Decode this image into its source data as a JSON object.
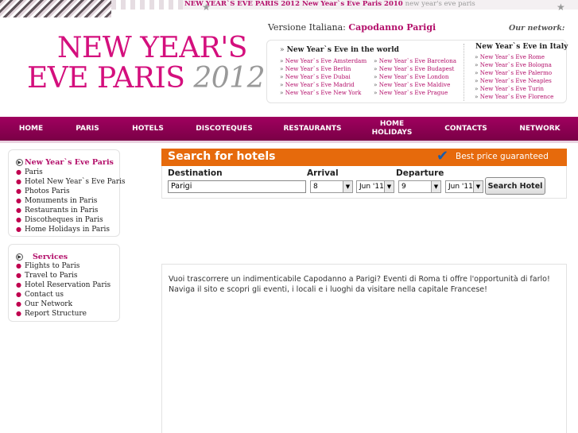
{
  "topbar": {
    "title1": "NEW YEAR`S EVE PARIS 2012",
    "title2": "New Year`s Eve Paris 2010",
    "title3": "new year's eve paris"
  },
  "logo": {
    "line1": "NEW YEAR'S",
    "line2": "EVE PARIS",
    "year": "2012"
  },
  "header": {
    "version_label": "Versione Italiana:",
    "version_link": "Capodanno Parigi",
    "our_network": "Our network:"
  },
  "world": {
    "title": "New Year`s Eve in the world",
    "col1": [
      "New Year`s Eve Amsterdam",
      "New Year`s Eve Berlin",
      "New Year`s Eve Dubai",
      "New Year`s Eve Madrid",
      "New Year`s Eve New York"
    ],
    "col2": [
      "New Year`s Eve Barcelona",
      "New Year`s Eve Budapest",
      "New Year`s Eve London",
      "New Year`s Eve Maldive",
      "New Year`s Eve Prague"
    ]
  },
  "italy": {
    "title": "New Year`s Eve in Italy",
    "items": [
      "New Year`s Eve Rome",
      "New Year`s Eve Bologna",
      "New Year`s Eve Palermo",
      "New Year`s Eve Neaples",
      "New Year`s Eve Turin",
      "New Year`s Eve Florence"
    ]
  },
  "nav": {
    "home": "HOME",
    "paris": "PARIS",
    "hotels": "HOTELS",
    "discoteques": "DISCOTEQUES",
    "restaurants": "RESTAURANTS",
    "home_holidays_1": "HOME",
    "home_holidays_2": "HOLIDAYS",
    "contacts": "CONTACTS",
    "network": "NETWORK"
  },
  "sidebar1": {
    "title": "New Year`s Eve Paris",
    "items": [
      "Paris",
      "Hotel New Year`s Eve Paris",
      "Photos Paris",
      "Monuments in Paris",
      "Restaurants in Paris",
      "Discotheques in Paris",
      "Home Holidays in Paris"
    ]
  },
  "sidebar2": {
    "title": "Services",
    "items": [
      "Flights to Paris",
      "Travel to Paris",
      "Hotel Reservation Paris",
      "Contact us",
      "Our Network",
      "Report Structure"
    ]
  },
  "search": {
    "title": "Search for hotels",
    "best_price": "Best price guaranteed",
    "destination_label": "Destination",
    "destination_value": "Parigi",
    "arrival_label": "Arrival",
    "arrival_day": "8",
    "arrival_month": "Jun '11",
    "departure_label": "Departure",
    "departure_day": "9",
    "departure_month": "Jun '11",
    "button": "Search Hotel"
  },
  "intro": {
    "text": "Vuoi trascorrere un indimenticabile Capodanno a Parigi? Eventi di Roma ti offre l'opportunità di farlo! Naviga il sito e scopri gli eventi, i locali e i luoghi da visitare nella capitale Francese!"
  },
  "colors": {
    "brand": "#d40f7d",
    "nav": "#8e0052",
    "search_bar": "#e66a0c"
  }
}
